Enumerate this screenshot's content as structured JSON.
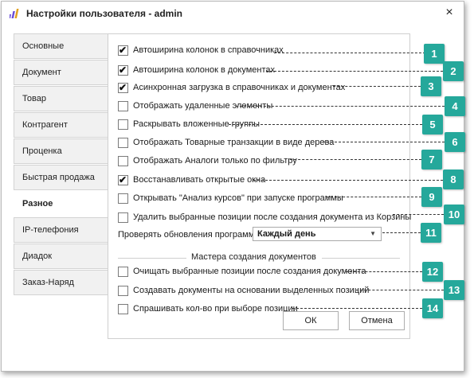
{
  "window": {
    "title": "Настройки пользователя - admin",
    "close_label": "×"
  },
  "tabs": [
    {
      "label": "Основные",
      "active": false
    },
    {
      "label": "Документ",
      "active": false
    },
    {
      "label": "Товар",
      "active": false
    },
    {
      "label": "Контрагент",
      "active": false
    },
    {
      "label": "Проценка",
      "active": false
    },
    {
      "label": "Быстрая продажа",
      "active": false
    },
    {
      "label": "Разное",
      "active": true
    },
    {
      "label": "IP-телефония",
      "active": false
    },
    {
      "label": "Диадок",
      "active": false
    },
    {
      "label": "Заказ-Наряд",
      "active": false
    }
  ],
  "options": [
    {
      "label": "Автоширина колонок в справочниках",
      "checked": true
    },
    {
      "label": "Автоширина колонок в документах",
      "checked": true
    },
    {
      "label": "Асинхронная загрузка в справочниках и документах",
      "checked": true
    },
    {
      "label": "Отображать удаленные элементы",
      "checked": false
    },
    {
      "label": "Раскрывать вложенные группы",
      "checked": false
    },
    {
      "label": "Отображать Товарные транзакции в виде дерева",
      "checked": false
    },
    {
      "label": "Отображать Аналоги только по фильтру",
      "checked": false
    },
    {
      "label": "Восстанавливать открытые окна",
      "checked": true
    },
    {
      "label": "Открывать \"Анализ курсов\" при запуске программы",
      "checked": false
    },
    {
      "label": "Удалить выбранные позиции после создания документа из Корзины",
      "checked": false
    }
  ],
  "updates": {
    "label": "Проверять обновления программы",
    "value": "Каждый день"
  },
  "wizards": {
    "title": "Мастера создания документов",
    "options": [
      {
        "label": "Очищать выбранные позиции после создания документа",
        "checked": false
      },
      {
        "label": "Создавать документы на основании выделенных позиций",
        "checked": false
      },
      {
        "label": "Спрашивать кол-во при выборе позиции",
        "checked": false
      }
    ]
  },
  "buttons": {
    "ok": "ОК",
    "cancel": "Отмена"
  },
  "callouts": [
    "1",
    "2",
    "3",
    "4",
    "5",
    "6",
    "7",
    "8",
    "9",
    "10",
    "11",
    "12",
    "13",
    "14"
  ],
  "colors": {
    "callout": "#25a89b",
    "app_icon": "#6b4fd8"
  },
  "icons": {
    "app": "app-logo-icon",
    "close": "close-icon",
    "dropdown": "chevron-down-icon",
    "check": "checkmark-icon"
  }
}
